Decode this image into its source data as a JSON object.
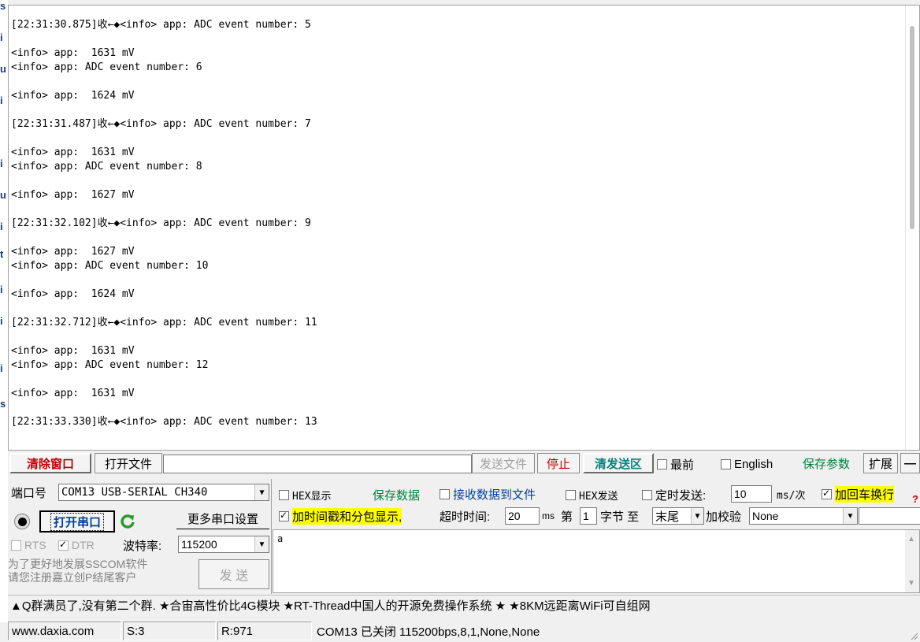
{
  "receive_log": [
    "[22:31:30.875]收←◆<info> app: ADC event number: 5",
    "",
    "<info> app:  1631 mV",
    "<info> app: ADC event number: 6",
    "",
    "<info> app:  1624 mV",
    "",
    "[22:31:31.487]收←◆<info> app: ADC event number: 7",
    "",
    "<info> app:  1631 mV",
    "<info> app: ADC event number: 8",
    "",
    "<info> app:  1627 mV",
    "",
    "[22:31:32.102]收←◆<info> app: ADC event number: 9",
    "",
    "<info> app:  1627 mV",
    "<info> app: ADC event number: 10",
    "",
    "<info> app:  1624 mV",
    "",
    "[22:31:32.712]收←◆<info> app: ADC event number: 11",
    "",
    "<info> app:  1631 mV",
    "<info> app: ADC event number: 12",
    "",
    "<info> app:  1631 mV",
    "",
    "[22:31:33.330]收←◆<info> app: ADC event number: 13"
  ],
  "toolbar": {
    "clear_window": "清除窗口",
    "open_file": "打开文件",
    "send_file": "发送文件",
    "stop": "停止",
    "clear_send": "清发送区",
    "topmost": "最前",
    "english": "English",
    "save_params": "保存参数",
    "expand": "扩展",
    "collapse": "—"
  },
  "port": {
    "port_label": "端口号",
    "port_value": "COM13 USB-SERIAL CH340",
    "open_port": "打开串口",
    "more_settings": "更多串口设置",
    "rts": "RTS",
    "dtr": "DTR",
    "baud_label": "波特率:",
    "baud_value": "115200",
    "promo_line1": "为了更好地发展SSCOM软件",
    "promo_line2": "请您注册嘉立创P结尾客户",
    "send_button": "发 送"
  },
  "options": {
    "hex_display": "HEX显示",
    "save_data": "保存数据",
    "recv_to_file": "接收数据到文件",
    "hex_send": "HEX发送",
    "timed_send": "定时发送:",
    "timed_value": "10",
    "ms_per": "ms/次",
    "add_crlf": "加回车换行",
    "timestamp": "加时间戳和分包显示,",
    "timeout_label": "超时时间:",
    "timeout_value": "20",
    "ms": "ms",
    "di": "第",
    "byte_index": "1",
    "byte_to": "字节 至",
    "end_value": "末尾",
    "checksum_label": "加校验",
    "checksum_value": "None"
  },
  "send_area": {
    "text": "a"
  },
  "marquee": "▲Q群满员了,没有第二个群. ★合宙高性价比4G模块 ★RT-Thread中国人的开源免费操作系统 ★ ★8KM远距离WiFi可自组网",
  "status": {
    "site": "www.daxia.com",
    "sent": "S:3",
    "received": "R:971",
    "port_state": "COM13 已关闭  115200bps,8,1,None,None"
  },
  "colors": {
    "highlight": "#ffff00",
    "accent_red": "#c00000",
    "accent_green": "#008040"
  }
}
